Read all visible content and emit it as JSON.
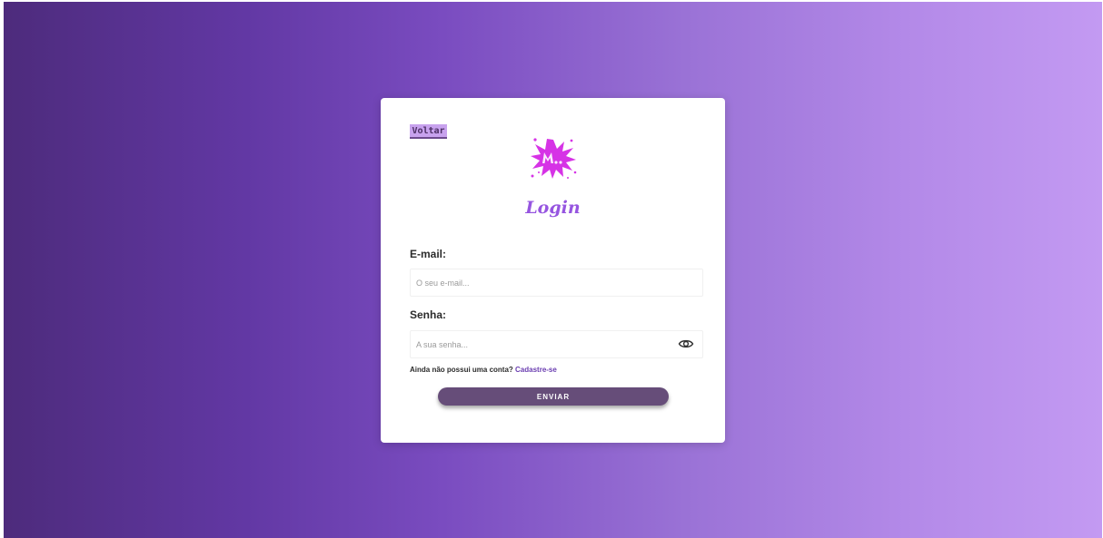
{
  "login": {
    "back_label": "Voltar",
    "title": "Login",
    "email": {
      "label": "E-mail:",
      "placeholder": "O seu e-mail...",
      "value": ""
    },
    "password": {
      "label": "Senha:",
      "placeholder": "A sua senha...",
      "value": ""
    },
    "signup_prompt": "Ainda não possui uma conta?",
    "signup_link": "Cadastre-se",
    "submit_label": "ENVIAR"
  },
  "icons": {
    "logo": "splash-logo-icon",
    "password_toggle": "eye-icon"
  },
  "colors": {
    "bg_start": "#4d2b7c",
    "bg_end": "#c39af2",
    "title": "#9655e0",
    "submit": "#664d79",
    "back_button": "#c8a2ee",
    "link": "#6a3db0",
    "logo": "#d633e6"
  }
}
